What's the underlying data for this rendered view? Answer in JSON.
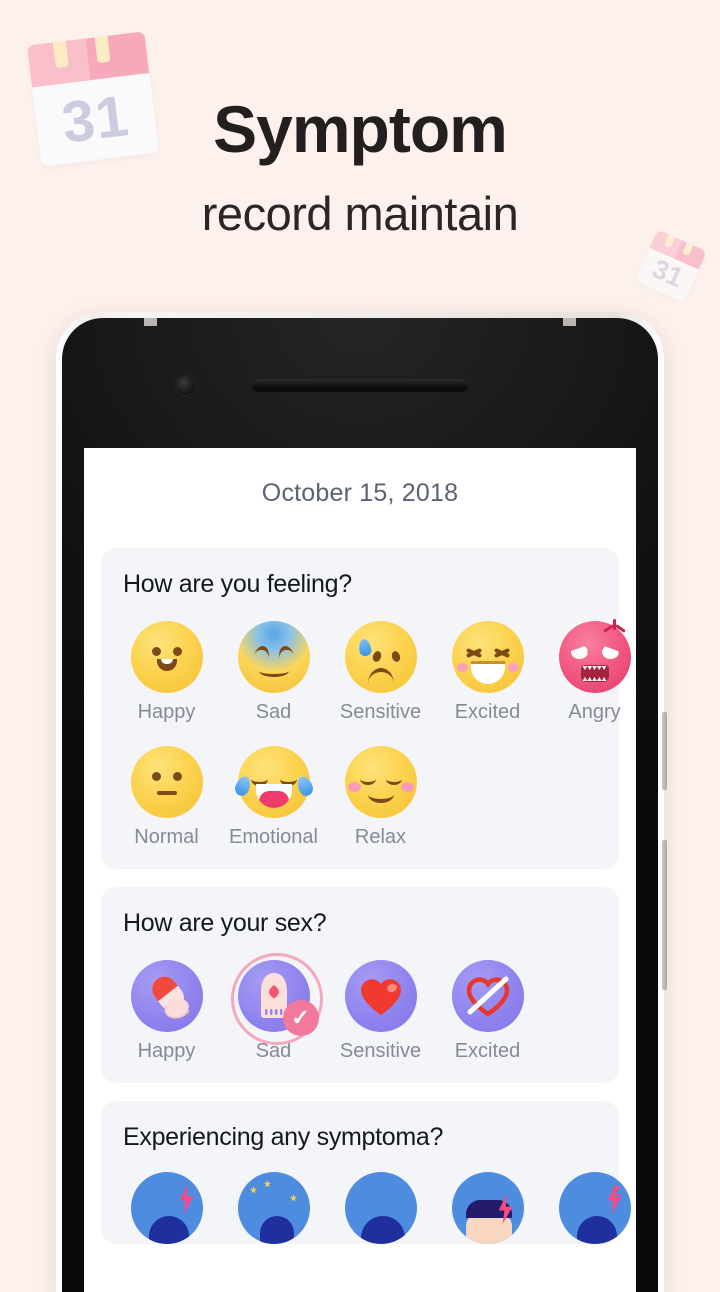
{
  "hero": {
    "title": "Symptom",
    "subtitle": "record maintain",
    "background_color": "#fdf1ed",
    "title_color": "#231f1e",
    "decor": [
      {
        "name": "calendar-decor-large",
        "day": "31"
      },
      {
        "name": "calendar-decor-small",
        "day": "31"
      }
    ]
  },
  "phone": {
    "frame_color": "#efecea",
    "bezel_color": "#111111",
    "parts": [
      "camera-icon",
      "earpiece-speaker",
      "volume-button",
      "power-button",
      "antenna-line-left",
      "antenna-line-right"
    ]
  },
  "screen": {
    "date": "October 15, 2018",
    "date_color": "#5b6273",
    "card_background": "#f4f5f9",
    "accent_purple": "#8f84ee",
    "accent_pink": "#f2799b",
    "cards": [
      {
        "id": "mood",
        "title": "How are you feeling?",
        "rows": [
          [
            {
              "label": "Happy",
              "icon": "emoji-happy-icon",
              "selected": false
            },
            {
              "label": "Sad",
              "icon": "emoji-sad-icon",
              "selected": false
            },
            {
              "label": "Sensitive",
              "icon": "emoji-sensitive-icon",
              "selected": false
            },
            {
              "label": "Excited",
              "icon": "emoji-excited-icon",
              "selected": false
            },
            {
              "label": "Angry",
              "icon": "emoji-angry-icon",
              "selected": false
            }
          ],
          [
            {
              "label": "Normal",
              "icon": "emoji-normal-icon",
              "selected": false
            },
            {
              "label": "Emotional",
              "icon": "emoji-emotional-icon",
              "selected": false
            },
            {
              "label": "Relax",
              "icon": "emoji-relax-icon",
              "selected": false
            }
          ]
        ]
      },
      {
        "id": "sex",
        "title": "How are your sex?",
        "rows": [
          [
            {
              "label": "Happy",
              "icon": "pills-icon",
              "selected": false
            },
            {
              "label": "Sad",
              "icon": "condom-icon",
              "selected": true
            },
            {
              "label": "Sensitive",
              "icon": "heart-icon",
              "selected": false
            },
            {
              "label": "Excited",
              "icon": "heart-crossed-out-icon",
              "selected": false
            }
          ]
        ]
      },
      {
        "id": "symptom",
        "title": "Experiencing any symptoma?",
        "rows": [
          [
            {
              "label": "",
              "icon": "symptom-cramps-icon",
              "selected": false
            },
            {
              "label": "",
              "icon": "symptom-dizzy-icon",
              "selected": false
            },
            {
              "label": "",
              "icon": "symptom-headache-icon",
              "selected": false
            },
            {
              "label": "",
              "icon": "symptom-fatigue-icon",
              "selected": false
            },
            {
              "label": "",
              "icon": "symptom-insomnia-icon",
              "selected": false
            }
          ]
        ]
      }
    ]
  }
}
